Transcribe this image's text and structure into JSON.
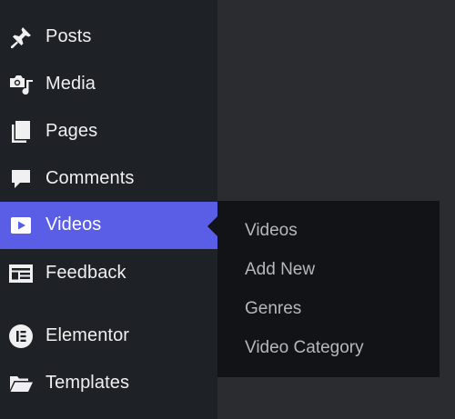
{
  "sidebar": {
    "items": [
      {
        "label": "Posts",
        "icon": "pushpin-icon"
      },
      {
        "label": "Media",
        "icon": "media-icon"
      },
      {
        "label": "Pages",
        "icon": "pages-icon"
      },
      {
        "label": "Comments",
        "icon": "comment-icon"
      },
      {
        "label": "Videos",
        "icon": "video-play-icon",
        "active": true
      },
      {
        "label": "Feedback",
        "icon": "feedback-icon"
      },
      {
        "label": "Elementor",
        "icon": "elementor-icon"
      },
      {
        "label": "Templates",
        "icon": "folder-icon"
      }
    ]
  },
  "flyout": {
    "items": [
      {
        "label": "Videos"
      },
      {
        "label": "Add New"
      },
      {
        "label": "Genres"
      },
      {
        "label": "Video Category"
      }
    ]
  },
  "colors": {
    "sidebar_bg": "#1e2125",
    "content_bg": "#2a2c30",
    "active_bg": "#5a5ee6",
    "flyout_bg": "#121317",
    "flyout_text": "#b4b8bd",
    "menu_text": "#f0f0f1"
  }
}
